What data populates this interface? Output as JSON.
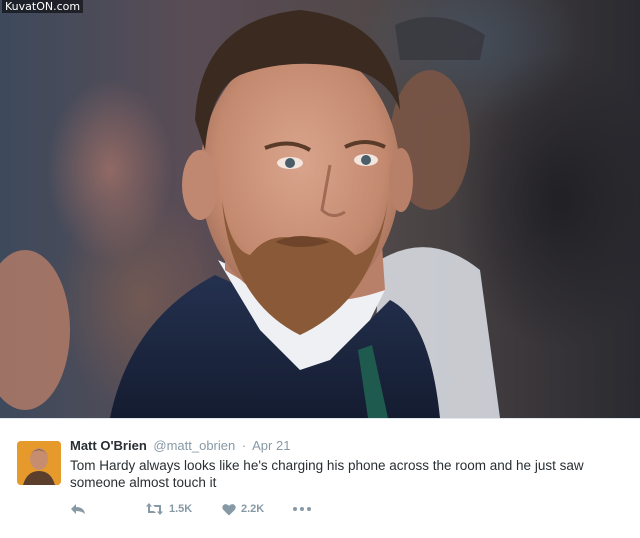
{
  "watermark": "KuvatON.com",
  "tweet": {
    "display_name": "Matt O'Brien",
    "handle": "@matt_obrien",
    "separator": "·",
    "time": "Apr 21",
    "text": "Tom Hardy always looks like he's charging his phone across the room and he just saw someone almost touch it",
    "actions": {
      "reply_icon": "reply-icon",
      "retweet_icon": "retweet-icon",
      "retweet_count": "1.5K",
      "like_icon": "heart-icon",
      "like_count": "2.2K",
      "more_icon": "more-dots-icon"
    }
  },
  "colors": {
    "name": "#292f33",
    "meta": "#8899a6",
    "border": "#e1e8ed"
  }
}
